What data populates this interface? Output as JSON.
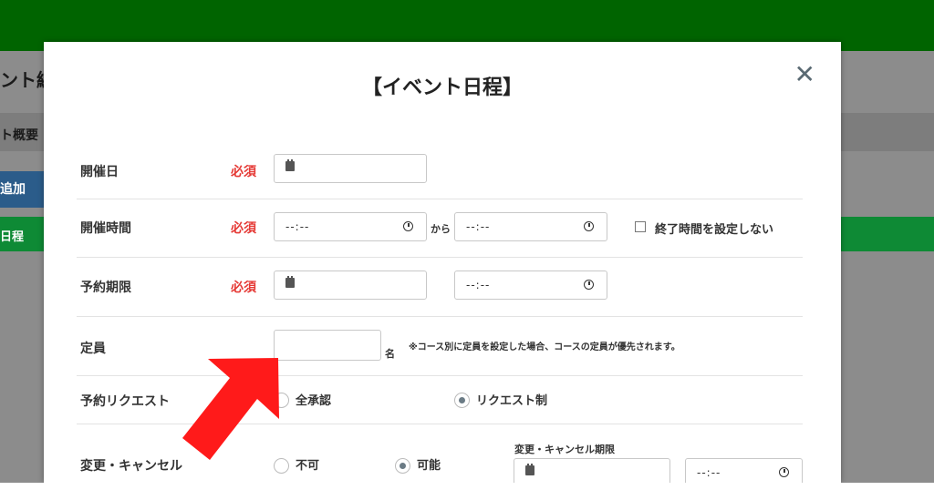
{
  "background": {
    "page_title_fragment": "ント編",
    "section_label_fragment": "ト概要",
    "add_button_fragment": "追加",
    "green_row_label": "日程"
  },
  "modal": {
    "title": "【イベント日程】",
    "close_label": "✕"
  },
  "rows": {
    "date": {
      "label": "開催日",
      "required": "必須"
    },
    "time": {
      "label": "開催時間",
      "required": "必須",
      "start_time": "--:--",
      "separator": "から",
      "end_time": "--:--",
      "no_end_time_label": "終了時間を設定しない"
    },
    "deadline": {
      "label": "予約期限",
      "required": "必須",
      "time": "--:--"
    },
    "capacity": {
      "label": "定員",
      "unit": "名",
      "note": "※コース別に定員を設定した場合、コースの定員が優先されます。"
    },
    "request": {
      "label": "予約リクエスト",
      "option_all": "全承認",
      "option_request": "リクエスト制"
    },
    "cancel": {
      "label": "変更・キャンセル",
      "option_no": "不可",
      "option_yes": "可能",
      "deadline_label": "変更・キャンセル期限",
      "time": "--:--"
    }
  },
  "colors": {
    "header_green": "#006400",
    "required_red": "#e53935",
    "arrow_red": "#ff1a1a"
  },
  "icons": [
    "calendar-icon",
    "clock-icon",
    "close-icon",
    "annotation-arrow"
  ]
}
